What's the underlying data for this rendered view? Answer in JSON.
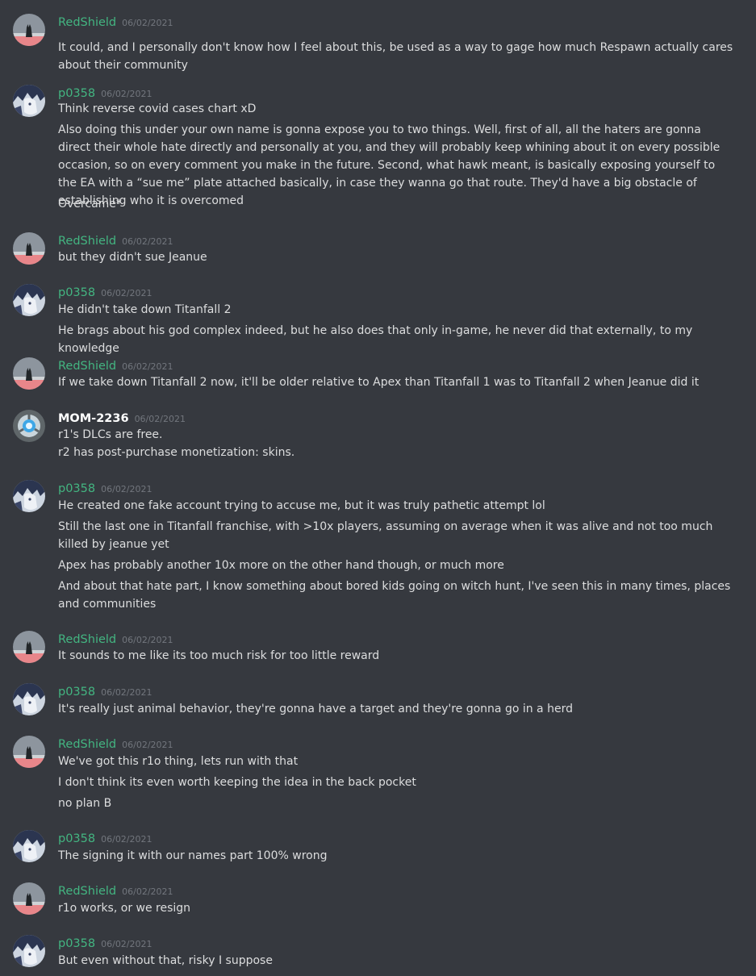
{
  "colors": {
    "background": "#36393f",
    "author_green": "#43b581",
    "author_white": "#ffffff",
    "timestamp": "#72767d",
    "text": "#dcddde"
  },
  "messages": [
    {
      "author": "RedShield",
      "color": "green",
      "avatar": "redshield-avatar-icon",
      "timestamp": "06/02/2021",
      "lines": [
        "It could, and I personally don't know how I feel about this, be used as a way to gage how much Respawn actually cares about their community"
      ]
    },
    {
      "author": "p0358",
      "color": "green",
      "avatar": "p0358-avatar-icon",
      "timestamp": "06/02/2021",
      "lines": [
        "Think reverse covid cases chart xD",
        "Also doing this under your own name is gonna expose you to two things. Well, first of all, all the haters are gonna direct their whole hate directly and personally at you, and they will probably keep whining about it on every possible occasion, so on every comment you make in the future. Second, what hawk meant, is basically exposing yourself to the EA with a “sue me” plate attached basically, in case they wanna go that route. They'd have a big obstacle of establishing who it is overcomed",
        "Overcame*"
      ]
    },
    {
      "author": "RedShield",
      "color": "green",
      "avatar": "redshield-avatar-icon",
      "timestamp": "06/02/2021",
      "lines": [
        "but they didn't sue Jeanue"
      ]
    },
    {
      "author": "p0358",
      "color": "green",
      "avatar": "p0358-avatar-icon",
      "timestamp": "06/02/2021",
      "lines": [
        "He didn't take down Titanfall 2",
        "He brags about his god complex indeed, but he also does that only in-game, he never did that externally, to my knowledge"
      ]
    },
    {
      "author": "RedShield",
      "color": "green",
      "avatar": "redshield-avatar-icon",
      "timestamp": "06/02/2021",
      "lines": [
        "If we take down Titanfall 2 now, it'll be older relative to Apex than Titanfall 1 was to Titanfall 2 when Jeanue did it"
      ]
    },
    {
      "author": "MOM-2236",
      "color": "white",
      "avatar": "mom-2236-avatar-icon",
      "timestamp": "06/02/2021",
      "lines": [
        "r1's DLCs are free.",
        "r2 has post-purchase monetization: skins."
      ]
    },
    {
      "author": "p0358",
      "color": "green",
      "avatar": "p0358-avatar-icon",
      "timestamp": "06/02/2021",
      "lines": [
        "He created one fake account trying to accuse me, but it was truly pathetic attempt lol",
        "Still the last one in Titanfall franchise, with >10x players, assuming on average when it was alive and not too much killed by jeanue yet",
        "Apex has probably another 10x more on the other hand though, or much more",
        "And about that hate part, I know something about bored kids going on witch hunt, I've seen this in many times, places and communities"
      ]
    },
    {
      "author": "RedShield",
      "color": "green",
      "avatar": "redshield-avatar-icon",
      "timestamp": "06/02/2021",
      "lines": [
        "It sounds to me like its too much risk for too little reward"
      ]
    },
    {
      "author": "p0358",
      "color": "green",
      "avatar": "p0358-avatar-icon",
      "timestamp": "06/02/2021",
      "lines": [
        "It's really just animal behavior, they're gonna have a target and they're gonna go in a herd"
      ]
    },
    {
      "author": "RedShield",
      "color": "green",
      "avatar": "redshield-avatar-icon",
      "timestamp": "06/02/2021",
      "lines": [
        "We've got this r1o thing, lets run with that",
        "I don't think its even worth keeping the idea in the back pocket",
        "no plan B"
      ]
    },
    {
      "author": "p0358",
      "color": "green",
      "avatar": "p0358-avatar-icon",
      "timestamp": "06/02/2021",
      "lines": [
        "The signing it with our names part 100% wrong"
      ]
    },
    {
      "author": "RedShield",
      "color": "green",
      "avatar": "redshield-avatar-icon",
      "timestamp": "06/02/2021",
      "lines": [
        "r1o works, or we resign"
      ]
    },
    {
      "author": "p0358",
      "color": "green",
      "avatar": "p0358-avatar-icon",
      "timestamp": "06/02/2021",
      "lines": [
        "But even without that, risky I suppose"
      ]
    }
  ]
}
